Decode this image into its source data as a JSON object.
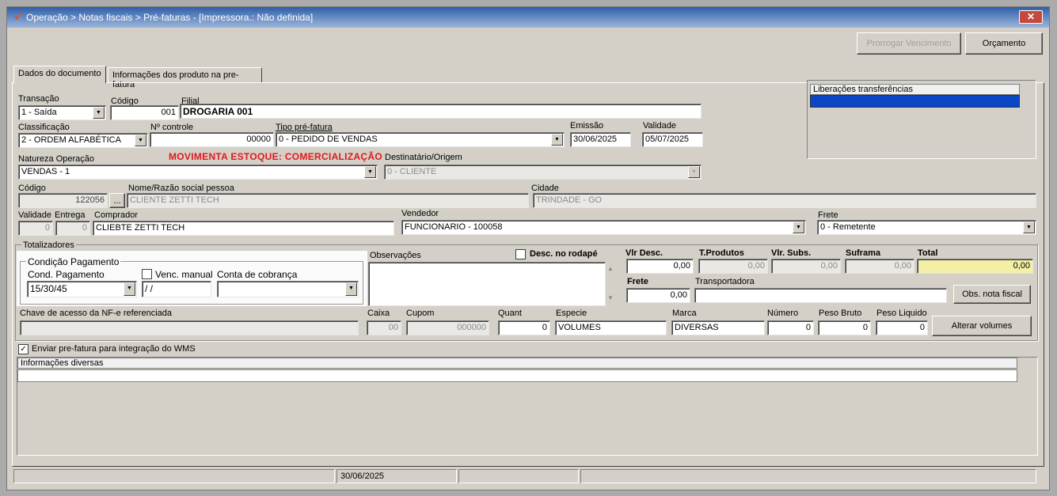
{
  "window": {
    "title": "Operação > Notas fiscais > Pré-faturas - [Impressora.: Não definida]",
    "close": "✕"
  },
  "toolbar": {
    "prorrogar": "Prorrogar Vencimento",
    "orcamento": "Orçamento"
  },
  "tabs": [
    "Dados do documento",
    "Informações dos produto na pre-fatura"
  ],
  "labels": {
    "transacao": "Transação",
    "codigo": "Código",
    "filial": "Filial",
    "classificacao": "Classificação",
    "ncontrole": "Nº controle",
    "tipo": "Tipo pré-fatura",
    "emissao": "Emissão",
    "validade": "Validade",
    "natureza": "Natureza  Operação",
    "movimenta": "MOVIMENTA ESTOQUE: COMERCIALIZAÇÃO",
    "destinatario": "Destinatário/Origem",
    "codigo2": "Código",
    "nome": "Nome/Razão social pessoa",
    "cidade": "Cidade",
    "validade2": "Validade",
    "entrega": "Entrega",
    "comprador": "Comprador",
    "vendedor": "Vendedor",
    "frete": "Frete",
    "totalizadores": "Totalizadores",
    "condicao": "Condição Pagamento",
    "condpag": "Cond. Pagamento",
    "vencmanual": "Venc. manual",
    "conta": "Conta de cobrança",
    "observacoes": "Observações",
    "descrodape": "Desc. no rodapé",
    "vlrdesc": "Vlr Desc.",
    "tprodutos": "T.Produtos",
    "vlrsubs": "Vlr. Subs.",
    "suframa": "Suframa",
    "total": "Total",
    "frete2": "Frete",
    "transportadora": "Transportadora",
    "chave": "Chave de acesso da NF-e referenciada",
    "caixa": "Caixa",
    "cupom": "Cupom",
    "quant": "Quant",
    "especie": "Especie",
    "marca": "Marca",
    "numero": "Número",
    "pesobruto": "Peso Bruto",
    "pesoliquido": "Peso Liquido",
    "enviar": "Enviar pre-fatura para integração do WMS",
    "infodiversas": "Informações diversas",
    "liberacoes": "Liberações transferências"
  },
  "values": {
    "transacao": "1 - Saída",
    "codigo": "001",
    "filial": "DROGARIA 001",
    "classificacao": "2 - ORDEM ALFABÉTICA",
    "ncontrole": "00000",
    "tipo": "0 - PEDIDO DE VENDAS",
    "emissao": "30/06/2025",
    "validade": "05/07/2025",
    "natureza": "VENDAS - 1",
    "destinatario": "0 - CLIENTE",
    "codigo2": "122056",
    "nome": "CLIENTE ZETTI TECH",
    "cidade": "TRINDADE - GO",
    "validade2": "0",
    "entrega": "0",
    "comprador": "CLIEBTE ZETTI TECH",
    "vendedor": "FUNCIONARIO - 100058",
    "frete": "0 - Remetente",
    "condpag": "15/30/45",
    "vencdata": " /  /",
    "conta": "",
    "vlrdesc": "0,00",
    "tprodutos": "0,00",
    "vlrsubs": "0,00",
    "suframa": "0,00",
    "total": "0,00",
    "frete2": "0,00",
    "transportadora": "",
    "chave": "",
    "caixa": "00",
    "cupom": "000000",
    "quant": "0",
    "especie": "VOLUMES",
    "marca": "DIVERSAS",
    "numero": "0",
    "pesobruto": "0",
    "pesoliquido": "0"
  },
  "buttons": {
    "obs": "Obs. nota fiscal",
    "alterar": "Alterar volumes",
    "ellipsis": "..."
  },
  "status": {
    "date": "30/06/2025"
  },
  "colors": {
    "total_bg": "#f3efa6",
    "selection": "#0a46c6",
    "red_label": "#e0191c"
  }
}
